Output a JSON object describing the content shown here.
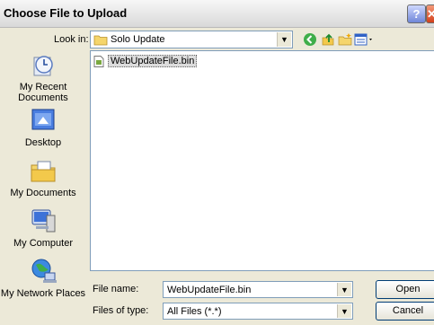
{
  "window": {
    "title": "Choose File to Upload",
    "help_glyph": "?",
    "close_glyph": "✕"
  },
  "look_in": {
    "label": "Look in:",
    "value": "Solo Update",
    "icon": "folder-icon"
  },
  "toolbar": {
    "icons": [
      "back-icon",
      "up-folder-icon",
      "new-folder-icon",
      "view-menu-icon"
    ]
  },
  "places": [
    {
      "label": "My Recent Documents",
      "icon": "recent-documents-icon"
    },
    {
      "label": "Desktop",
      "icon": "desktop-icon"
    },
    {
      "label": "My Documents",
      "icon": "my-documents-icon"
    },
    {
      "label": "My Computer",
      "icon": "my-computer-icon"
    },
    {
      "label": "My Network Places",
      "icon": "network-places-icon"
    }
  ],
  "files": [
    {
      "name": "WebUpdateFile.bin",
      "icon": "bin-file-icon"
    }
  ],
  "file_name": {
    "label": "File name:",
    "value": "WebUpdateFile.bin"
  },
  "file_type": {
    "label": "Files of type:",
    "value": "All Files (*.*)"
  },
  "buttons": {
    "open": "Open",
    "cancel": "Cancel"
  }
}
